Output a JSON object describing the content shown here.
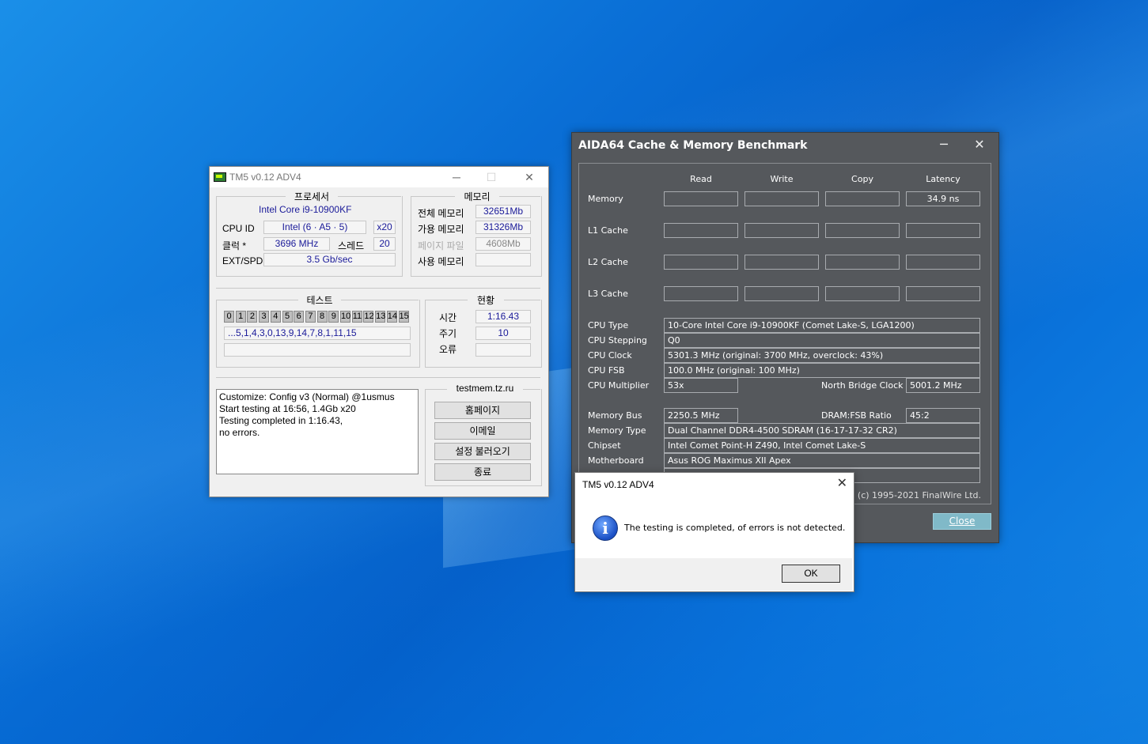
{
  "tm5": {
    "title": "TM5 v0.12 ADV4",
    "processor": {
      "group": "프로세서",
      "name": "Intel Core i9-10900KF",
      "cpuid_label": "CPU ID",
      "cpuid_value": "Intel  (6 · A5 · 5)",
      "multiplier": "x20",
      "clock_label": "클럭 *",
      "clock_value": "3696 MHz",
      "threads_label": "스레드",
      "threads_value": "20",
      "ext_label": "EXT/SPD",
      "ext_value": "3.5 Gb/sec"
    },
    "memory": {
      "group": "메모리",
      "total_label": "전체 메모리",
      "total_value": "32651Mb",
      "avail_label": "가용 메모리",
      "avail_value": "31326Mb",
      "page_label": "페이지 파일",
      "page_value": "4608Mb",
      "used_label": "사용 메모리",
      "used_value": ""
    },
    "test": {
      "group": "테스트",
      "cells": [
        "0",
        "1",
        "2",
        "3",
        "4",
        "5",
        "6",
        "7",
        "8",
        "9",
        "10",
        "11",
        "12",
        "13",
        "14",
        "15"
      ],
      "sequence": "...5,1,4,3,0,13,9,14,7,8,1,11,15"
    },
    "status": {
      "group": "현황",
      "time_label": "시간",
      "time_value": "1:16.43",
      "cycle_label": "주기",
      "cycle_value": "10",
      "error_label": "오류",
      "error_value": ""
    },
    "log": [
      "Customize: Config v3 (Normal) @1usmus",
      "Start testing at 16:56, 1.4Gb x20",
      "Testing completed in 1:16.43,",
      "no errors."
    ],
    "links": {
      "site": "testmem.tz.ru",
      "homepage": "홈페이지",
      "email": "이메일",
      "load_config": "설정 불러오기",
      "exit": "종료"
    }
  },
  "aida": {
    "title": "AIDA64 Cache & Memory Benchmark",
    "headers": [
      "Read",
      "Write",
      "Copy",
      "Latency"
    ],
    "rows": [
      {
        "label": "Memory",
        "values": [
          "",
          "",
          "",
          "34.9 ns"
        ]
      },
      {
        "label": "L1 Cache",
        "values": [
          "",
          "",
          "",
          ""
        ]
      },
      {
        "label": "L2 Cache",
        "values": [
          "",
          "",
          "",
          ""
        ]
      },
      {
        "label": "L3 Cache",
        "values": [
          "",
          "",
          "",
          ""
        ]
      }
    ],
    "info": {
      "cpu_type_label": "CPU Type",
      "cpu_type": "10-Core Intel Core i9-10900KF  (Comet Lake-S, LGA1200)",
      "cpu_stepping_label": "CPU Stepping",
      "cpu_stepping": "Q0",
      "cpu_clock_label": "CPU Clock",
      "cpu_clock": "5301.3 MHz  (original: 3700 MHz, overclock: 43%)",
      "cpu_fsb_label": "CPU FSB",
      "cpu_fsb": "100.0 MHz  (original: 100 MHz)",
      "cpu_mult_label": "CPU Multiplier",
      "cpu_mult": "53x",
      "nb_clock_label": "North Bridge Clock",
      "nb_clock": "5001.2 MHz",
      "mem_bus_label": "Memory Bus",
      "mem_bus": "2250.5 MHz",
      "dram_ratio_label": "DRAM:FSB Ratio",
      "dram_ratio": "45:2",
      "mem_type_label": "Memory Type",
      "mem_type": "Dual Channel DDR4-4500 SDRAM  (16-17-17-32 CR2)",
      "chipset_label": "Chipset",
      "chipset": "Intel Comet Point-H Z490, Intel Comet Lake-S",
      "motherboard_label": "Motherboard",
      "motherboard": "Asus ROG Maximus XII Apex"
    },
    "footer": "64  (c) 1995-2021 FinalWire Ltd.",
    "close": "Close"
  },
  "dialog": {
    "title": "TM5 v0.12 ADV4",
    "message": "The testing is completed, of errors is not detected.",
    "ok": "OK"
  }
}
